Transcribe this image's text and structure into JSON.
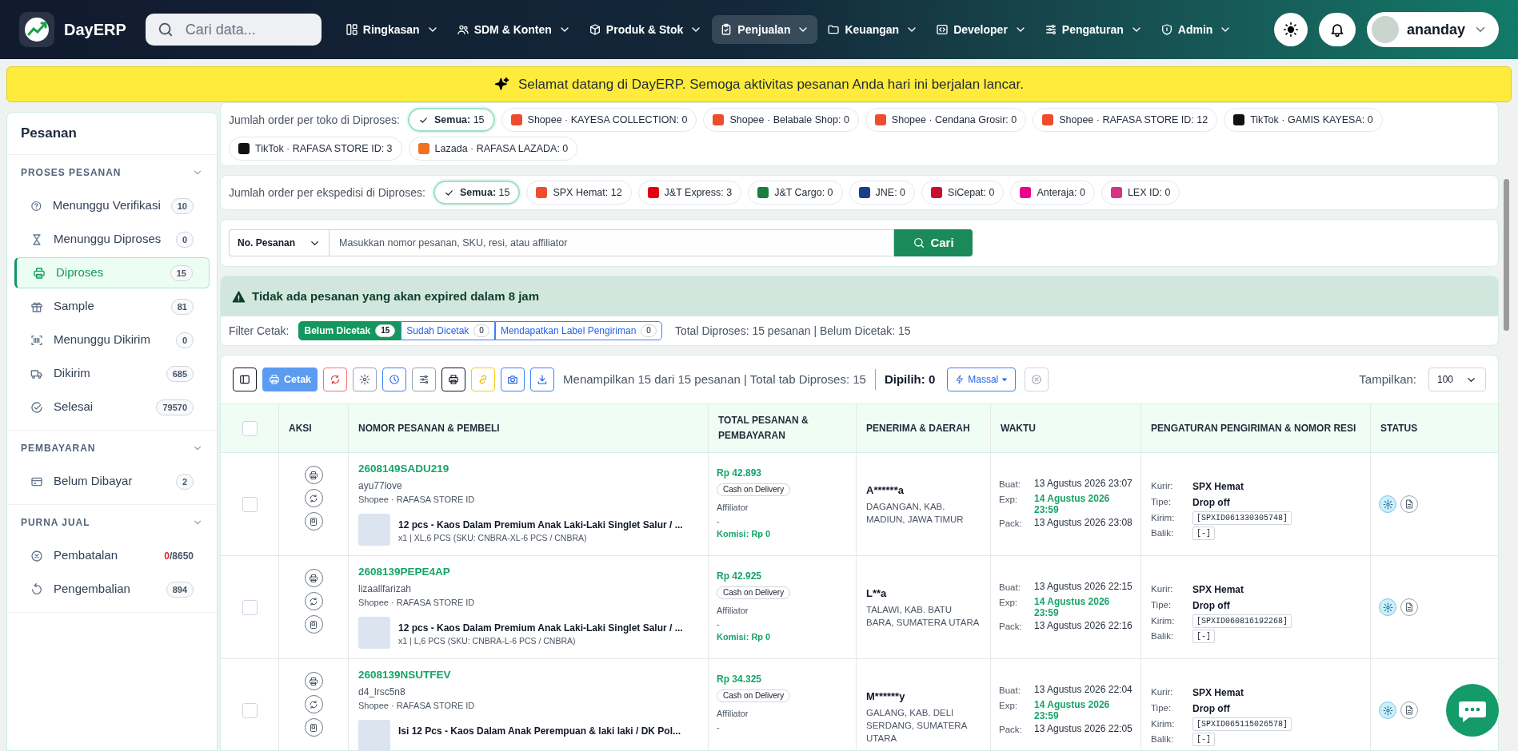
{
  "app": {
    "name": "DayERP",
    "search_placeholder": "Cari data..."
  },
  "nav": [
    {
      "label": "Ringkasan",
      "kind": "layout",
      "selected": false
    },
    {
      "label": "SDM & Konten",
      "kind": "users",
      "selected": false
    },
    {
      "label": "Produk & Stok",
      "kind": "box",
      "selected": false
    },
    {
      "label": "Penjualan",
      "kind": "clipboard",
      "selected": true
    },
    {
      "label": "Keuangan",
      "kind": "folder",
      "selected": false
    },
    {
      "label": "Developer",
      "kind": "code",
      "selected": false
    },
    {
      "label": "Pengaturan",
      "kind": "sliders",
      "selected": false
    },
    {
      "label": "Admin",
      "kind": "shield",
      "selected": false
    }
  ],
  "user": {
    "name": "ananday"
  },
  "banner": "Selamat datang di DayERP. Semoga aktivitas pesanan Anda hari ini berjalan lancar.",
  "sidebar": {
    "title": "Pesanan",
    "sections": [
      {
        "title": "PROSES PESANAN",
        "expanded": true,
        "items": [
          {
            "label": "Menunggu Verifikasi",
            "kind": "question",
            "count": "10",
            "selected": false
          },
          {
            "label": "Menunggu Diproses",
            "kind": "hourglass",
            "count": "0",
            "selected": false
          },
          {
            "label": "Diproses",
            "kind": "printer",
            "count": "15",
            "selected": true
          },
          {
            "label": "Sample",
            "kind": "gift",
            "count": "81",
            "selected": false
          },
          {
            "label": "Menunggu Dikirim",
            "kind": "barcode",
            "count": "0",
            "selected": false
          },
          {
            "label": "Dikirim",
            "kind": "truck",
            "count": "685",
            "selected": false
          },
          {
            "label": "Selesai",
            "kind": "checkcircle",
            "count": "79570",
            "selected": false
          }
        ]
      },
      {
        "title": "PEMBAYARAN",
        "expanded": true,
        "items": [
          {
            "label": "Belum Dibayar",
            "kind": "card",
            "count": "2",
            "selected": false
          }
        ]
      },
      {
        "title": "PURNA JUAL",
        "expanded": true,
        "items": [
          {
            "label": "Pembatalan",
            "kind": "xcircle",
            "count_alert": "0",
            "count": "/8650",
            "selected": false
          },
          {
            "label": "Pengembalian",
            "kind": "rotate",
            "count": "894",
            "selected": false
          }
        ]
      }
    ]
  },
  "store_filter": {
    "label": "Jumlah order per toko di Diproses:",
    "chips": [
      {
        "label": "**Semua:** 15",
        "kind": "all",
        "selected": true
      },
      {
        "label": "Shopee · KAYESA COLLECTION: 0",
        "kind": "shopee",
        "selected": false
      },
      {
        "label": "Shopee · Belabale Shop: 0",
        "kind": "shopee",
        "selected": false
      },
      {
        "label": "Shopee · Cendana Grosir: 0",
        "kind": "shopee",
        "selected": false
      },
      {
        "label": "Shopee · RAFASA STORE ID: 12",
        "kind": "shopee",
        "selected": false
      },
      {
        "label": "TikTok · GAMIS KAYESA: 0",
        "kind": "tiktok",
        "selected": false
      },
      {
        "label": "TikTok · RAFASA STORE ID: 3",
        "kind": "tiktok",
        "selected": false
      },
      {
        "label": "Lazada · RAFASA LAZADA: 0",
        "kind": "lazada",
        "selected": false
      }
    ]
  },
  "courier_filter": {
    "label": "Jumlah order per ekspedisi di Diproses:",
    "chips": [
      {
        "label": "**Semua:** 15",
        "kind": "all",
        "selected": true
      },
      {
        "label": "SPX Hemat: 12",
        "kind": "spx",
        "selected": false
      },
      {
        "label": "J&T Express: 3",
        "kind": "jnt",
        "selected": false
      },
      {
        "label": "J&T Cargo: 0",
        "kind": "jntcargo",
        "selected": false
      },
      {
        "label": "JNE: 0",
        "kind": "jne",
        "selected": false
      },
      {
        "label": "SiCepat: 0",
        "kind": "sicepat",
        "selected": false
      },
      {
        "label": "Anteraja: 0",
        "kind": "anteraja",
        "selected": false
      },
      {
        "label": "LEX ID: 0",
        "kind": "lex",
        "selected": false
      }
    ]
  },
  "search": {
    "field": "No. Pesanan",
    "placeholder": "Masukkan nomor pesanan, SKU, resi, atau affiliator",
    "button": "Cari"
  },
  "alert": "Tidak ada pesanan yang akan expired dalam 8 jam",
  "print_filter": {
    "label": "Filter Cetak:",
    "options": [
      {
        "label": "Belum Dicetak",
        "count": "15",
        "selected": true
      },
      {
        "label": "Sudah Dicetak",
        "count": "0",
        "selected": false
      },
      {
        "label": "Mendapatkan Label Pengiriman",
        "count": "0",
        "selected": false
      }
    ],
    "summary": "Total Diproses: 15 pesanan | Belum Dicetak: 15"
  },
  "toolbar": {
    "buttons": [
      {
        "kind": "panel"
      },
      {
        "kind": "print",
        "label": "Cetak"
      },
      {
        "kind": "refresh"
      },
      {
        "kind": "gear"
      },
      {
        "kind": "clock"
      },
      {
        "kind": "sliders"
      },
      {
        "kind": "printer"
      },
      {
        "kind": "link"
      },
      {
        "kind": "camera"
      },
      {
        "kind": "download"
      }
    ],
    "info": "Menampilkan 15 dari 15 pesanan | Total tab Diproses: 15",
    "selected_count": "Dipilih: 0",
    "bulk": "Massal",
    "show_label": "Tampilkan:",
    "show_value": "100"
  },
  "table": {
    "all_selected": false,
    "columns": [
      "AKSI",
      "NOMOR PESANAN & PEMBELI",
      "TOTAL PESANAN & PEMBAYARAN",
      "PENERIMA & DAERAH",
      "WAKTU",
      "PENGATURAN PENGIRIMAN & NOMOR RESI",
      "STATUS"
    ],
    "rows": [
      {
        "selected": false,
        "order_no": "2608149SADU219",
        "buyer": "ayu77love",
        "store": "Shopee · RAFASA STORE ID",
        "product": "12 pcs - Kaos Dalam Premium Anak Laki-Laki Singlet Salur / ...",
        "product_detail": "x1 | XL,6 PCS (SKU: CNBRA-XL-6 PCS / CNBRA)",
        "total": "Rp 42.893",
        "payment": "Cash on Delivery",
        "affiliator_label": "Affiliator",
        "affiliator": "-",
        "commission": "Komisi: Rp 0",
        "recipient": "A******a",
        "region": "DAGANGAN, KAB. MADIUN, JAWA TIMUR",
        "times": [
          {
            "label": "Buat:",
            "value": "13 Agustus 2026 23:07",
            "highlight": false
          },
          {
            "label": "Exp:",
            "value": "14 Agustus 2026 23:59",
            "highlight": true
          },
          {
            "label": "Pack:",
            "value": "13 Agustus 2026 23:08",
            "highlight": false
          }
        ],
        "shipping": [
          {
            "label": "Kurir:",
            "value": "SPX Hemat",
            "kind": "text"
          },
          {
            "label": "Tipe:",
            "value": "Drop off",
            "kind": "text"
          },
          {
            "label": "Kirim:",
            "value": "[SPXID061330305748]",
            "kind": "code"
          },
          {
            "label": "Balik:",
            "value": "[-]",
            "kind": "code"
          }
        ]
      },
      {
        "selected": false,
        "order_no": "2608139PEPE4AP",
        "buyer": "lizaallfarizah",
        "store": "Shopee · RAFASA STORE ID",
        "product": "12 pcs - Kaos Dalam Premium Anak Laki-Laki Singlet Salur / ...",
        "product_detail": "x1 | L,6 PCS (SKU: CNBRA-L-6 PCS / CNBRA)",
        "total": "Rp 42.925",
        "payment": "Cash on Delivery",
        "affiliator_label": "Affiliator",
        "affiliator": "-",
        "commission": "Komisi: Rp 0",
        "recipient": "L**a",
        "region": "TALAWI, KAB. BATU BARA, SUMATERA UTARA",
        "times": [
          {
            "label": "Buat:",
            "value": "13 Agustus 2026 22:15",
            "highlight": false
          },
          {
            "label": "Exp:",
            "value": "14 Agustus 2026 23:59",
            "highlight": true
          },
          {
            "label": "Pack:",
            "value": "13 Agustus 2026 22:16",
            "highlight": false
          }
        ],
        "shipping": [
          {
            "label": "Kurir:",
            "value": "SPX Hemat",
            "kind": "text"
          },
          {
            "label": "Tipe:",
            "value": "Drop off",
            "kind": "text"
          },
          {
            "label": "Kirim:",
            "value": "[SPXID060816192268]",
            "kind": "code"
          },
          {
            "label": "Balik:",
            "value": "[-]",
            "kind": "code"
          }
        ]
      },
      {
        "selected": false,
        "order_no": "2608139NSUTFEV",
        "buyer": "d4_lrsc5n8",
        "store": "Shopee · RAFASA STORE ID",
        "product": "Isi 12 Pcs - Kaos Dalam Anak Perempuan & laki laki / DK Pol...",
        "total": "Rp 34.325",
        "payment": "Cash on Delivery",
        "affiliator_label": "Affiliator",
        "affiliator": "-",
        "recipient": "M******y",
        "region": "GALANG, KAB. DELI SERDANG, SUMATERA UTARA",
        "times": [
          {
            "label": "Buat:",
            "value": "13 Agustus 2026 22:04",
            "highlight": false
          },
          {
            "label": "Exp:",
            "value": "14 Agustus 2026 23:59",
            "highlight": true
          },
          {
            "label": "Pack:",
            "value": "13 Agustus 2026 22:05",
            "highlight": false
          }
        ],
        "shipping": [
          {
            "label": "Kurir:",
            "value": "SPX Hemat",
            "kind": "text"
          },
          {
            "label": "Tipe:",
            "value": "Drop off",
            "kind": "text"
          },
          {
            "label": "Kirim:",
            "value": "[SPXID065115026578]",
            "kind": "code"
          },
          {
            "label": "Balik:",
            "value": "[-]",
            "kind": "code"
          }
        ]
      }
    ]
  }
}
